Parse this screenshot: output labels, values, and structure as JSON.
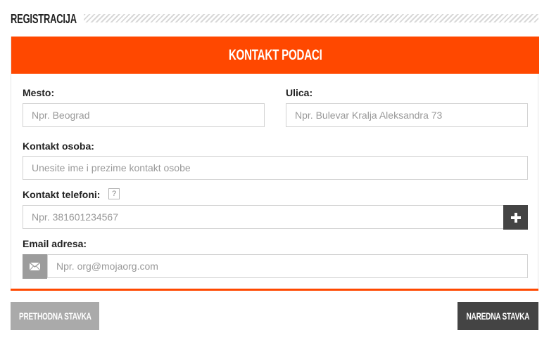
{
  "page": {
    "title": "REGISTRACIJA"
  },
  "section": {
    "title": "KONTAKT PODACI"
  },
  "form": {
    "mesto": {
      "label": "Mesto:",
      "placeholder": "Npr. Beograd"
    },
    "ulica": {
      "label": "Ulica:",
      "placeholder": "Npr. Bulevar Kralja Aleksandra 73"
    },
    "kontakt_osoba": {
      "label": "Kontakt osoba:",
      "placeholder": "Unesite ime i prezime kontakt osobe"
    },
    "kontakt_telefoni": {
      "label": "Kontakt telefoni:",
      "help": "?",
      "placeholder": "Npr. 381601234567",
      "add_icon": "plus-icon"
    },
    "email": {
      "label": "Email adresa:",
      "placeholder": "Npr. org@mojaorg.com",
      "icon": "envelope-icon"
    }
  },
  "navigation": {
    "prev_label": "PRETHODNA STAVKA",
    "next_label": "NAREDNA STAVKA"
  },
  "colors": {
    "accent": "#ff4800",
    "dark_button": "#444444",
    "gray_button": "#aaaaaa"
  }
}
